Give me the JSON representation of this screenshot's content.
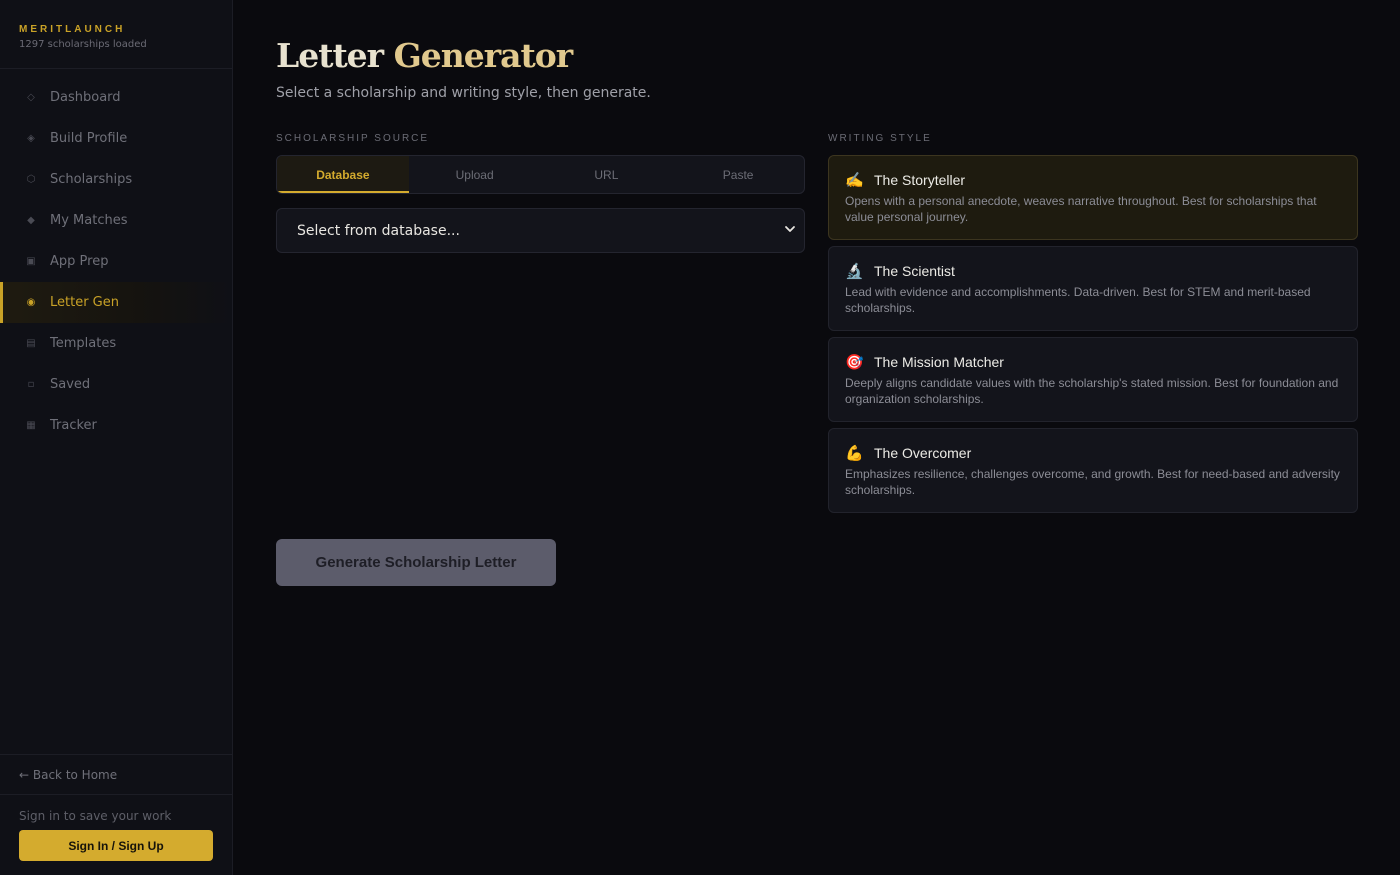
{
  "brand": {
    "name": "MERITLAUNCH",
    "subtitle": "1297 scholarships loaded"
  },
  "nav": {
    "items": [
      {
        "label": "Dashboard",
        "icon": "diamond-outline-icon",
        "glyph": "◇",
        "active": false
      },
      {
        "label": "Build Profile",
        "icon": "diamond-dot-icon",
        "glyph": "◈",
        "active": false
      },
      {
        "label": "Scholarships",
        "icon": "hexagon-icon",
        "glyph": "⬡",
        "active": false
      },
      {
        "label": "My Matches",
        "icon": "diamond-filled-icon",
        "glyph": "◆",
        "active": false
      },
      {
        "label": "App Prep",
        "icon": "square-dot-icon",
        "glyph": "▣",
        "active": false
      },
      {
        "label": "Letter Gen",
        "icon": "target-circle-icon",
        "glyph": "◉",
        "active": true
      },
      {
        "label": "Templates",
        "icon": "list-square-icon",
        "glyph": "▤",
        "active": false
      },
      {
        "label": "Saved",
        "icon": "small-dot-icon",
        "glyph": "▫",
        "active": false
      },
      {
        "label": "Tracker",
        "icon": "grid-square-icon",
        "glyph": "▦",
        "active": false
      }
    ],
    "back_home": "← Back to Home"
  },
  "auth": {
    "note": "Sign in to save your work",
    "button": "Sign In / Sign Up"
  },
  "main": {
    "title_part1": "Letter ",
    "title_part2": "Generator",
    "subtitle": "Select a scholarship and writing style, then generate."
  },
  "source": {
    "label": "SCHOLARSHIP SOURCE",
    "tabs": [
      {
        "label": "Database",
        "active": true
      },
      {
        "label": "Upload",
        "active": false
      },
      {
        "label": "URL",
        "active": false
      },
      {
        "label": "Paste",
        "active": false
      }
    ],
    "select_value": "Select from database..."
  },
  "writing_style": {
    "label": "WRITING STYLE",
    "cards": [
      {
        "emoji": "✍️",
        "icon": "writing-hand-icon",
        "title": "The Storyteller",
        "desc": "Opens with a personal anecdote, weaves narrative throughout. Best for scholarships that value personal journey.",
        "selected": true
      },
      {
        "emoji": "🔬",
        "icon": "microscope-icon",
        "title": "The Scientist",
        "desc": "Lead with evidence and accomplishments. Data-driven. Best for STEM and merit-based scholarships.",
        "selected": false
      },
      {
        "emoji": "🎯",
        "icon": "target-icon",
        "title": "The Mission Matcher",
        "desc": "Deeply aligns candidate values with the scholarship's stated mission. Best for foundation and organization scholarships.",
        "selected": false
      },
      {
        "emoji": "💪",
        "icon": "flexed-arm-icon",
        "title": "The Overcomer",
        "desc": "Emphasizes resilience, challenges overcome, and growth. Best for need-based and adversity scholarships.",
        "selected": false
      }
    ]
  },
  "generate_button": "Generate Scholarship Letter",
  "colors": {
    "accent": "#d4ab2e",
    "background": "#0a0a0e",
    "sidebar": "#0f1016"
  }
}
